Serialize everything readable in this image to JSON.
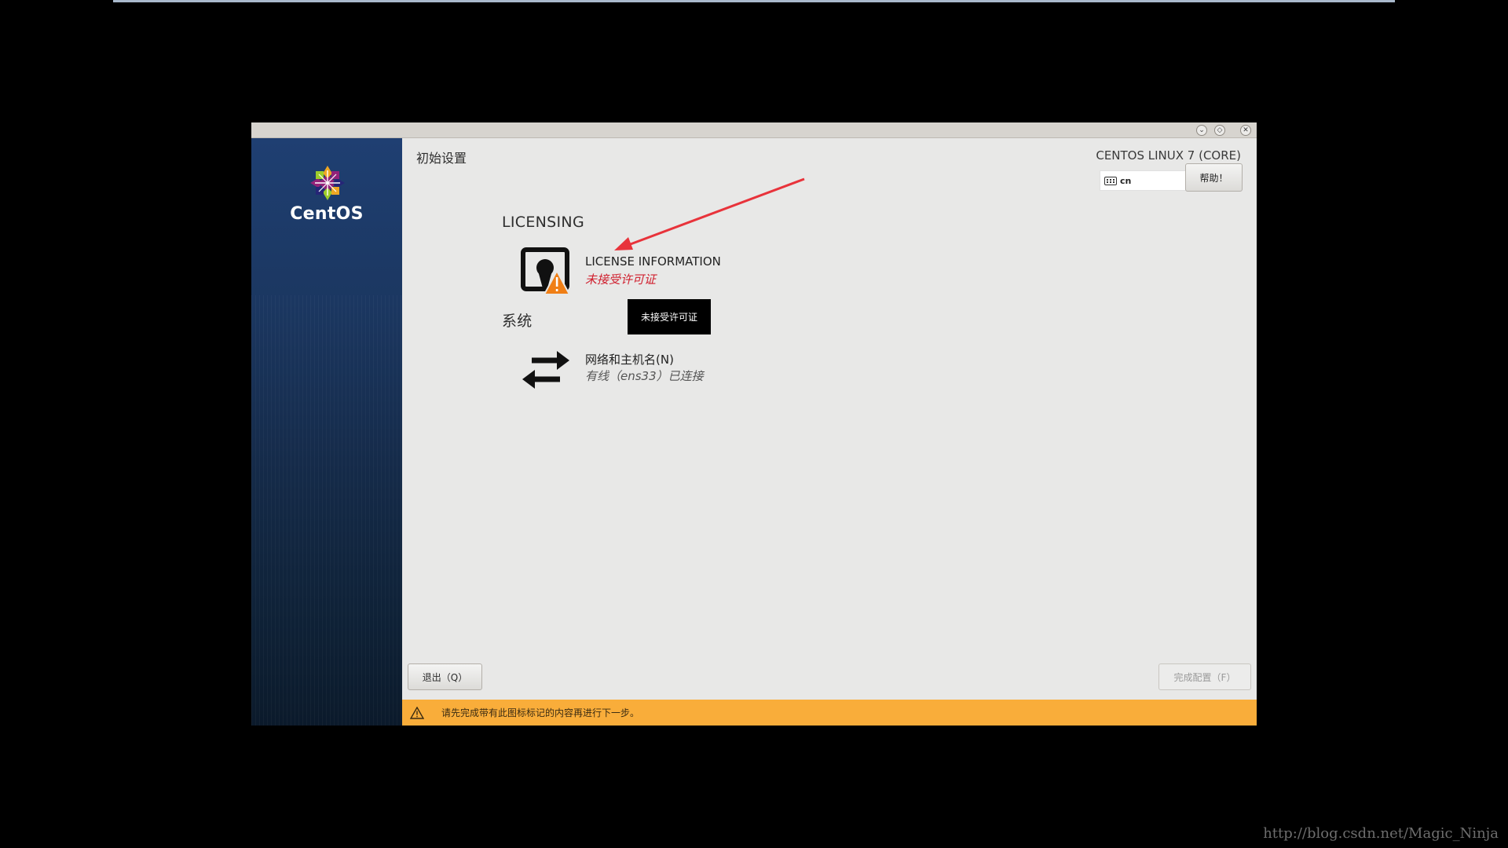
{
  "window": {
    "title_buttons": {
      "minimize": "⌄",
      "maximize": "◇",
      "close": "✕"
    }
  },
  "sidebar": {
    "logo_icon": "centos-logo-icon",
    "brand": "CentOS"
  },
  "header": {
    "spoke_title": "初始设置",
    "product": "CENTOS LINUX 7 (CORE)",
    "keyboard_layout": "cn",
    "help_label": "帮助！"
  },
  "categories": [
    {
      "title": "LICENSING",
      "spokes": [
        {
          "name": "LICENSE INFORMATION",
          "status": "未接受许可证",
          "icon": "license-warning-icon",
          "status_color": "#d0202f"
        }
      ]
    },
    {
      "title": "系统",
      "spokes": [
        {
          "name": "网络和主机名(N)",
          "status": "有线（ens33）已连接",
          "icon": "network-arrows-icon",
          "status_color": "#555555"
        }
      ]
    }
  ],
  "tooltip": "未接受许可证",
  "footer": {
    "quit_label": "退出（Q）",
    "done_label": "完成配置（F）",
    "warning": "请先完成带有此图标标记的内容再进行下一步。"
  },
  "watermark": "http://blog.csdn.net/Magic_Ninja",
  "colors": {
    "sidebar_top": "#1f3f72",
    "warning_bar": "#f9ad3a",
    "status_error": "#d0202f",
    "annotation_arrow": "#e8333b"
  }
}
